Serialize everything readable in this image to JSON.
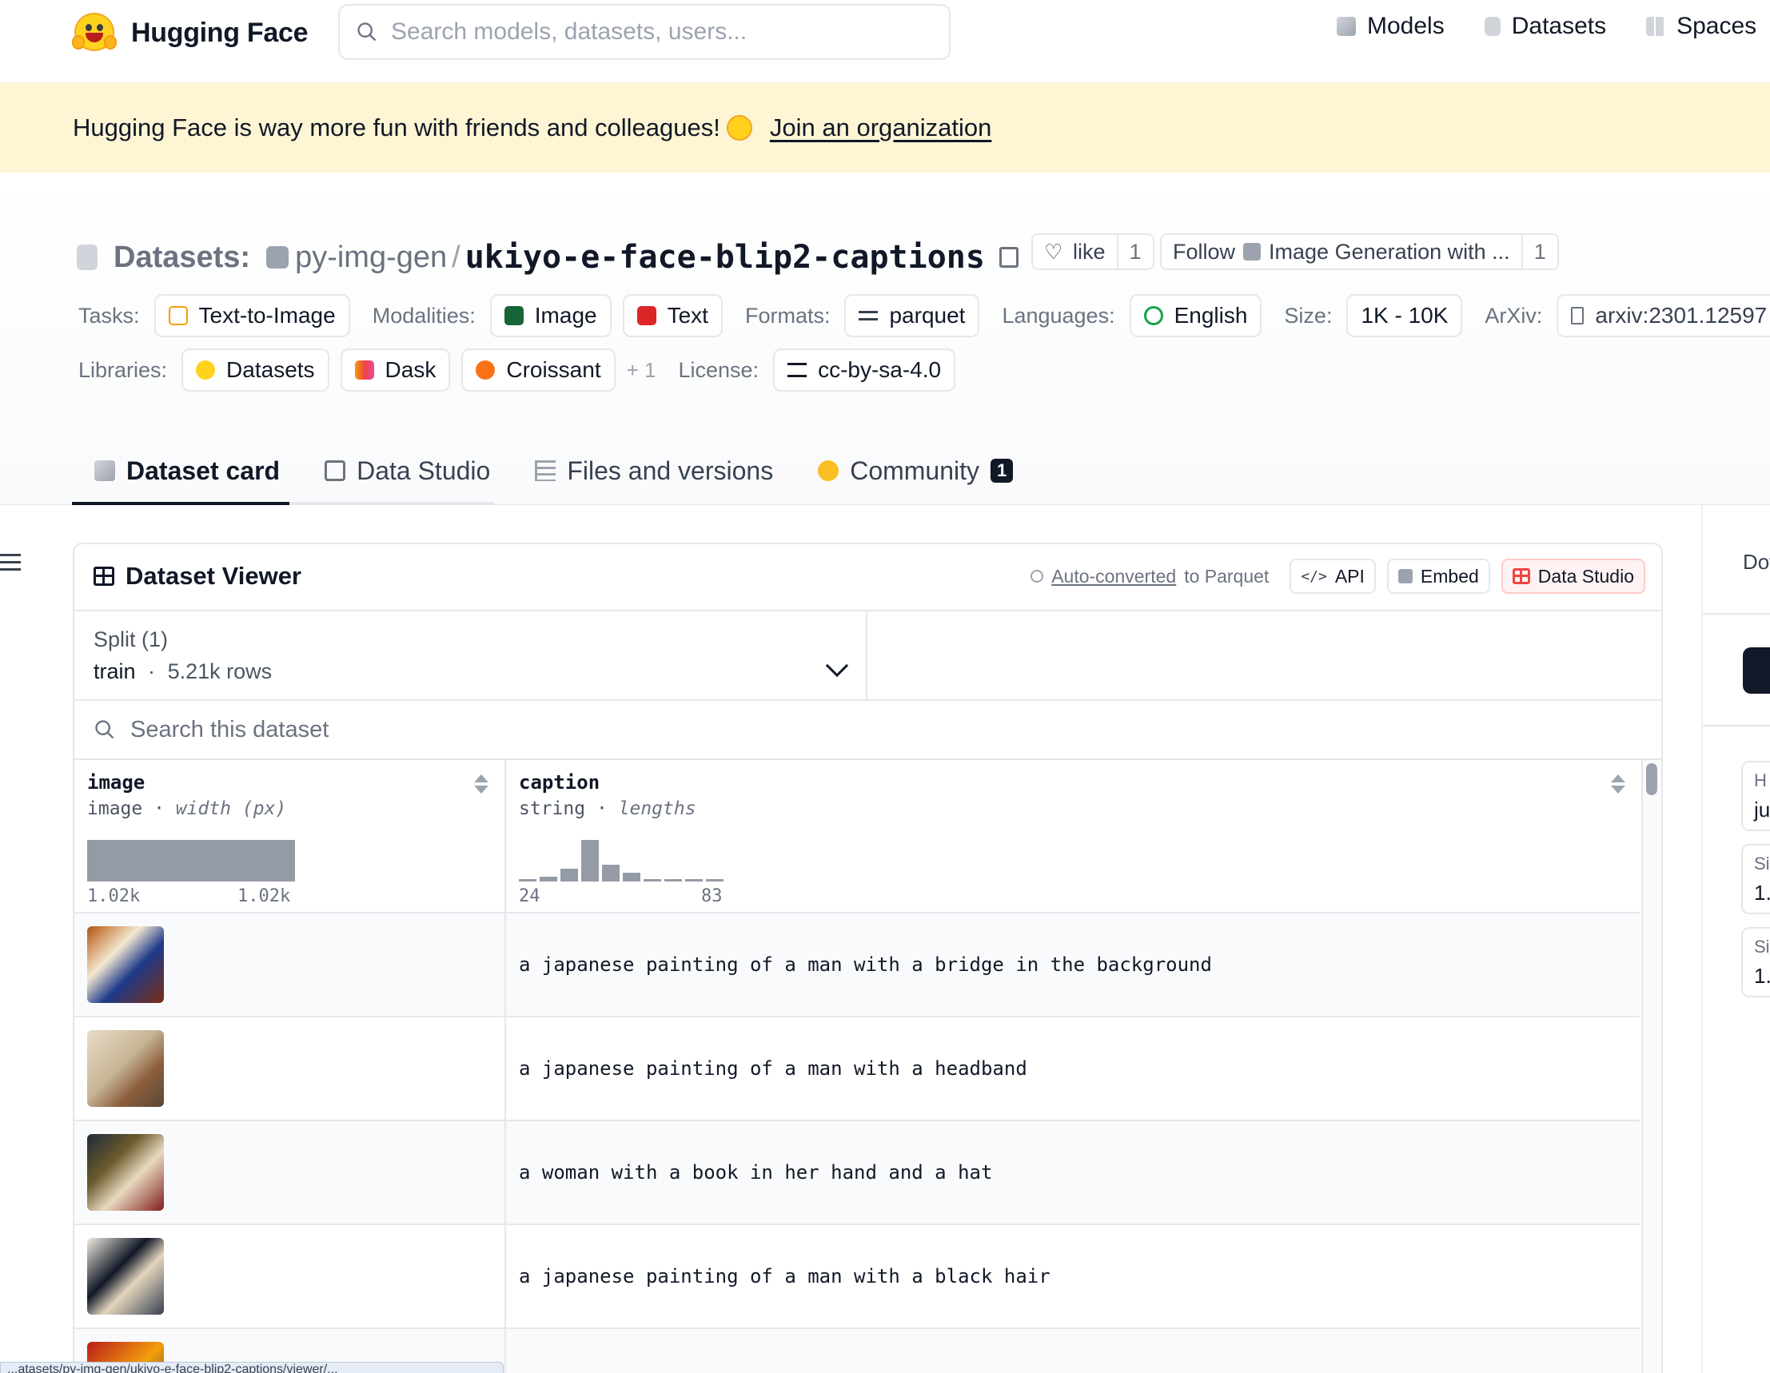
{
  "colors": {
    "banner_bg": "#fef5d4",
    "accent_yellow": "#ffd21e",
    "histogram_bar": "#959ba6",
    "data_studio_red": "#ef4444"
  },
  "header": {
    "brand": "Hugging Face",
    "search_placeholder": "Search models, datasets, users...",
    "nav": [
      {
        "label": "Models",
        "icon": "cube-icon"
      },
      {
        "label": "Datasets",
        "icon": "database-icon"
      },
      {
        "label": "Spaces",
        "icon": "spaces-grid-icon"
      }
    ]
  },
  "banner": {
    "text": "Hugging Face is way more fun with friends and colleagues!",
    "link": "Join an organization"
  },
  "repo": {
    "section_label": "Datasets:",
    "owner": "py-img-gen",
    "slash": "/",
    "name": "ukiyo-e-face-blip2-captions",
    "like_label": "like",
    "like_count": "1",
    "follow_label": "Follow",
    "follow_org": "Image Generation with ...",
    "follow_count": "1"
  },
  "tags": {
    "tasks_key": "Tasks:",
    "tasks": [
      "Text-to-Image"
    ],
    "modalities_key": "Modalities:",
    "modalities": [
      "Image",
      "Text"
    ],
    "formats_key": "Formats:",
    "formats": [
      "parquet"
    ],
    "languages_key": "Languages:",
    "languages": [
      "English"
    ],
    "size_key": "Size:",
    "size": "1K - 10K",
    "arxiv_key": "ArXiv:",
    "arxiv": "arxiv:2301.12597",
    "libraries_key": "Libraries:",
    "libraries": [
      "Datasets",
      "Dask",
      "Croissant"
    ],
    "libraries_more": "+ 1",
    "license_key": "License:",
    "license": "cc-by-sa-4.0"
  },
  "tabs": [
    {
      "label": "Dataset card",
      "active": true
    },
    {
      "label": "Data Studio",
      "active": false
    },
    {
      "label": "Files and versions",
      "active": false
    },
    {
      "label": "Community",
      "active": false,
      "badge": "1"
    }
  ],
  "viewer": {
    "title": "Dataset Viewer",
    "auto_link": "Auto-converted",
    "auto_rest": "to Parquet",
    "api_label": "API",
    "embed_label": "Embed",
    "studio_label": "Data Studio",
    "split_title": "Split (1)",
    "split_name": "train",
    "split_dot": "·",
    "split_rows": "5.21k rows",
    "search_placeholder": "Search this dataset",
    "columns": [
      {
        "name": "image",
        "type": "image",
        "stat": "width (px)",
        "min": "1.02k",
        "max": "1.02k"
      },
      {
        "name": "caption",
        "type": "string",
        "stat": "lengths",
        "min": "24",
        "max": "83",
        "histogram": [
          0.05,
          0.12,
          0.3,
          1.0,
          0.4,
          0.22,
          0.04,
          0.04,
          0.04,
          0.04
        ]
      }
    ],
    "rows": [
      {
        "caption": "a japanese painting of a man with a bridge in the background"
      },
      {
        "caption": "a japanese painting of a man with a headband"
      },
      {
        "caption": "a woman with a book in her hand and a hat"
      },
      {
        "caption": "a japanese painting of a man with a black hair"
      }
    ]
  },
  "sidebar_peek": {
    "download": "Dow",
    "card1_a": "H",
    "card1_b": "ju",
    "card2_a": "Si",
    "card2_b": "1.",
    "card3_a": "Si",
    "card3_b": "1."
  },
  "statusbar": {
    "text": "...atasets/py-img-gen/ukiyo-e-face-blip2-captions/viewer/..."
  }
}
